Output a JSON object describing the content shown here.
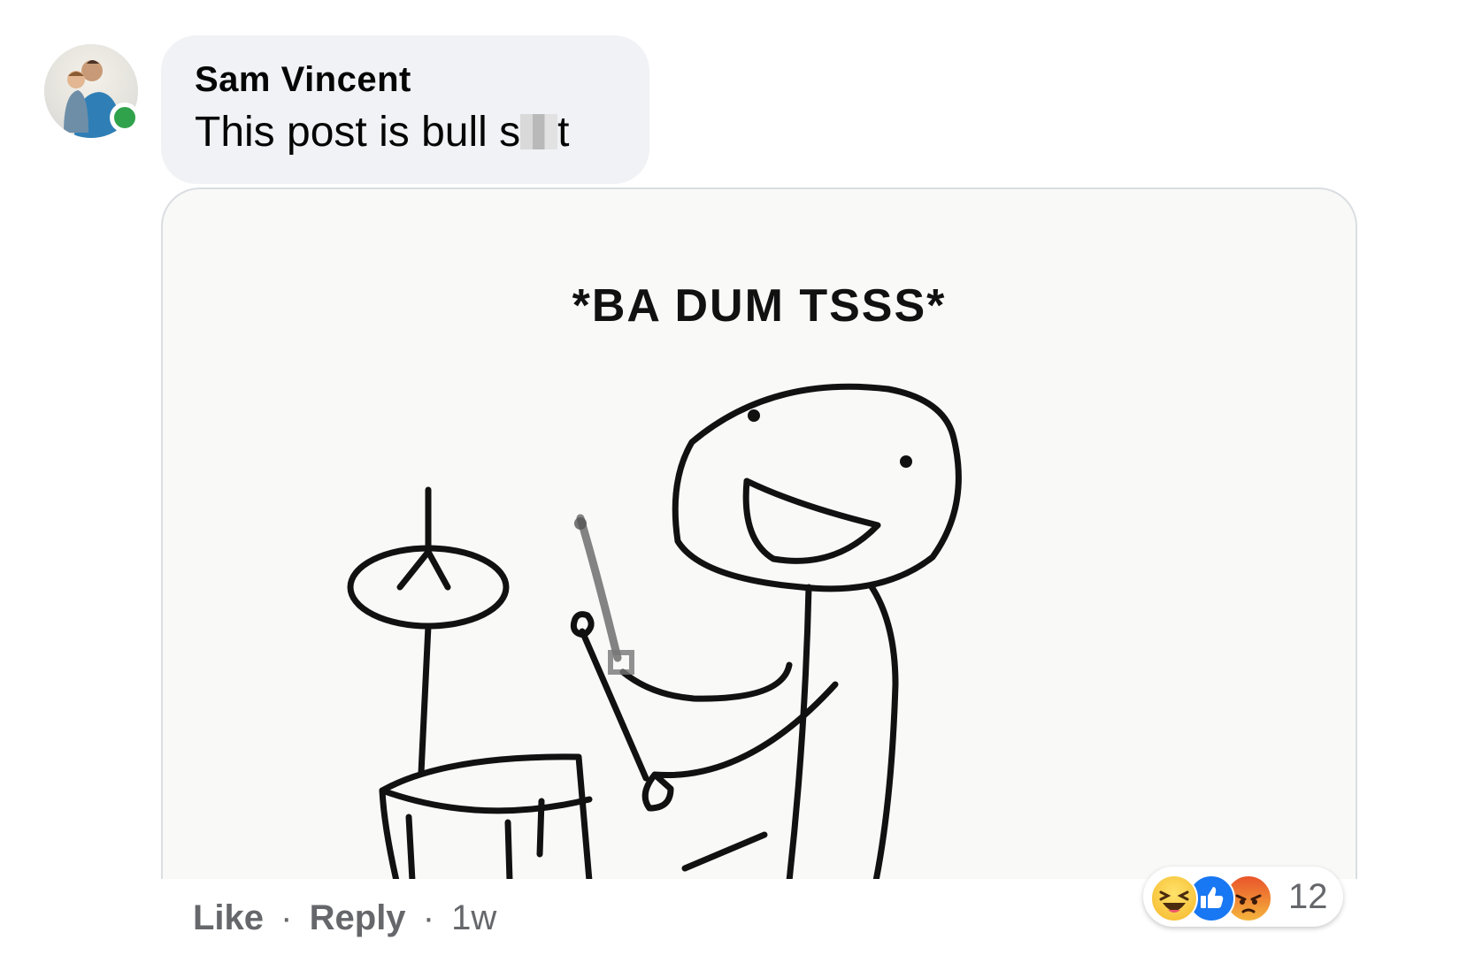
{
  "comment": {
    "author": "Sam Vincent",
    "text_start": "This post is bull s",
    "text_end": "t",
    "online": true
  },
  "gif": {
    "caption": "*BA DUM TSSS*"
  },
  "actions": {
    "like": "Like",
    "reply": "Reply",
    "separator": "·",
    "time": "1w"
  },
  "reactions": {
    "icons": [
      "haha-icon",
      "like-icon",
      "angry-icon"
    ],
    "count": "12"
  },
  "colors": {
    "bubble": "#f0f2f5",
    "online": "#31a24c",
    "like_blue": "#1877f2",
    "meta_text": "#65676b"
  }
}
